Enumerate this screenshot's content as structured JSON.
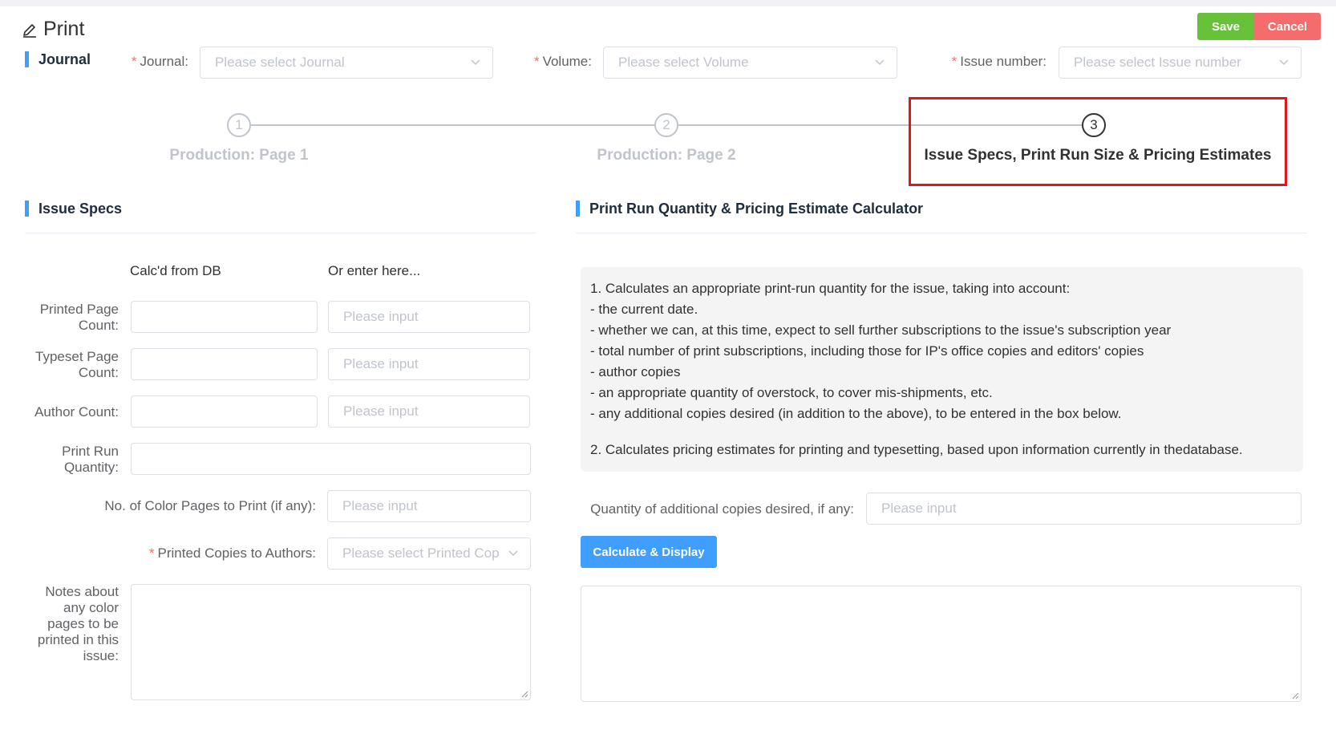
{
  "header": {
    "title": "Print",
    "save_label": "Save",
    "cancel_label": "Cancel",
    "accent_color": "#409eff",
    "save_color": "#67c23a",
    "cancel_color": "#f56c6c"
  },
  "journal_section": {
    "title": "Journal",
    "journal_label": "Journal:",
    "journal_placeholder": "Please select Journal",
    "volume_label": "Volume:",
    "volume_placeholder": "Please select Volume",
    "issue_label": "Issue number:",
    "issue_placeholder": "Please select Issue number",
    "required_mark": "*"
  },
  "steps": [
    {
      "number": "1",
      "label": "Production: Page 1",
      "active": false
    },
    {
      "number": "2",
      "label": "Production: Page 2",
      "active": false
    },
    {
      "number": "3",
      "label": "Issue Specs, Print Run Size & Pricing Estimates",
      "active": true
    }
  ],
  "issue_specs": {
    "title": "Issue Specs",
    "col_calc": "Calc'd from DB",
    "col_enter": "Or enter here...",
    "printed_page_count_label_1": "Printed Page",
    "printed_page_count_label_2": "Count:",
    "typeset_page_count_label_1": "Typeset Page",
    "typeset_page_count_label_2": "Count:",
    "author_count_label": "Author Count:",
    "print_run_label_1": "Print Run",
    "print_run_label_2": "Quantity:",
    "color_pages_label": "No. of Color Pages to Print (if any):",
    "printed_copies_label": "Printed Copies to Authors:",
    "printed_copies_placeholder": "Please select Printed Cop",
    "notes_label_1": "Notes about",
    "notes_label_2": "any color",
    "notes_label_3": "pages to be",
    "notes_label_4": "printed in this",
    "notes_label_5": "issue:",
    "input_placeholder": "Please input"
  },
  "calculator": {
    "title": "Print Run Quantity & Pricing Estimate Calculator",
    "lines": [
      "1. Calculates an appropriate print-run quantity for the issue, taking into account:",
      "- the current date.",
      "- whether we can, at this time, expect to sell further subscriptions to the issue's subscription year",
      "- total number of print subscriptions, including those for IP's office copies and editors' copies",
      "- author copies",
      "- an appropriate quantity of overstock, to cover mis-shipments, etc.",
      "- any additional copies desired (in addition to the above), to be entered in the box below."
    ],
    "line_2": "2. Calculates pricing estimates for printing and typesetting, based upon information currently in thedatabase.",
    "additional_label": "Quantity of additional copies desired, if any:",
    "additional_placeholder": "Please input",
    "calculate_label": "Calculate & Display"
  }
}
